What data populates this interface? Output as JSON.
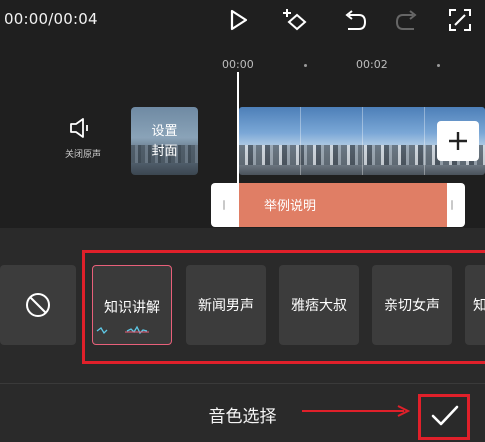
{
  "toolbar": {
    "time": "00:00/00:04",
    "icons": [
      "play-icon",
      "keyframe-icon",
      "undo-icon",
      "redo-icon",
      "fullscreen-icon"
    ]
  },
  "timeline": {
    "ruler": {
      "tick_0": "00:00",
      "tick_1": "00:02"
    },
    "mute": {
      "label": "关闭原声",
      "icon": "speaker-mute-icon"
    },
    "cover": {
      "label": "设置\n封面"
    },
    "add_clip_icon": "plus-icon",
    "text_clip": {
      "label": "举例说明",
      "color": "#e07e65"
    }
  },
  "voice_panel": {
    "title": "音色选择",
    "options": [
      {
        "label": "",
        "icon": "none-icon"
      },
      {
        "label": "知识讲解",
        "selected": true
      },
      {
        "label": "新闻男声"
      },
      {
        "label": "雅痞大叔"
      },
      {
        "label": "亲切女声"
      },
      {
        "label": "知"
      }
    ],
    "confirm_icon": "check-icon",
    "accent_color": "#e8607a",
    "annotation_color": "#e0202a"
  }
}
